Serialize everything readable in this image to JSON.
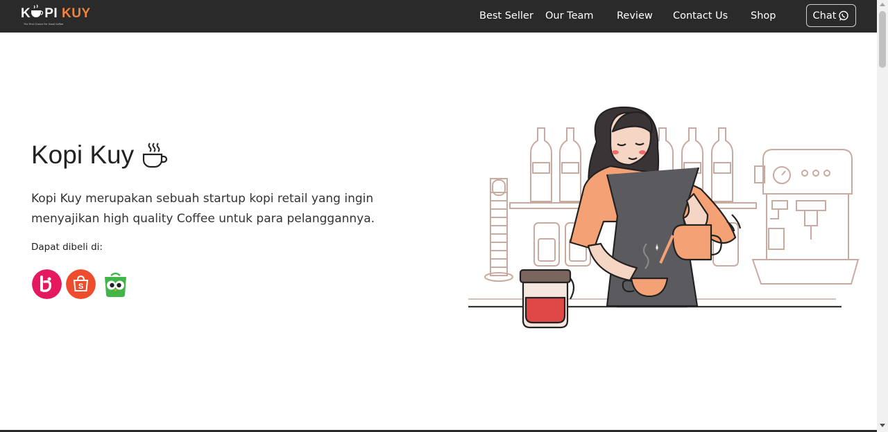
{
  "nav": {
    "logo": {
      "part1": "K",
      "part2": "PI",
      "part3": "KUY",
      "tagline": "The First Choice For Good Coffee"
    },
    "links": [
      "Best Seller",
      "Our Team",
      "Review",
      "Contact Us",
      "Shop"
    ],
    "chat_label": "Chat"
  },
  "hero": {
    "title": "Kopi Kuy",
    "description": "Kopi Kuy merupakan sebuah startup kopi retail yang ingin menyajikan high quality Coffee untuk para pelanggannya.",
    "buy_label": "Dapat dibeli di:",
    "stores": [
      "blibli",
      "shopee",
      "tokopedia"
    ]
  },
  "colors": {
    "navbar": "#2a2a2a",
    "accent": "#f0843c",
    "blibli": "#e5195f",
    "shopee": "#ee4d2d",
    "tokopedia": "#42b549"
  }
}
